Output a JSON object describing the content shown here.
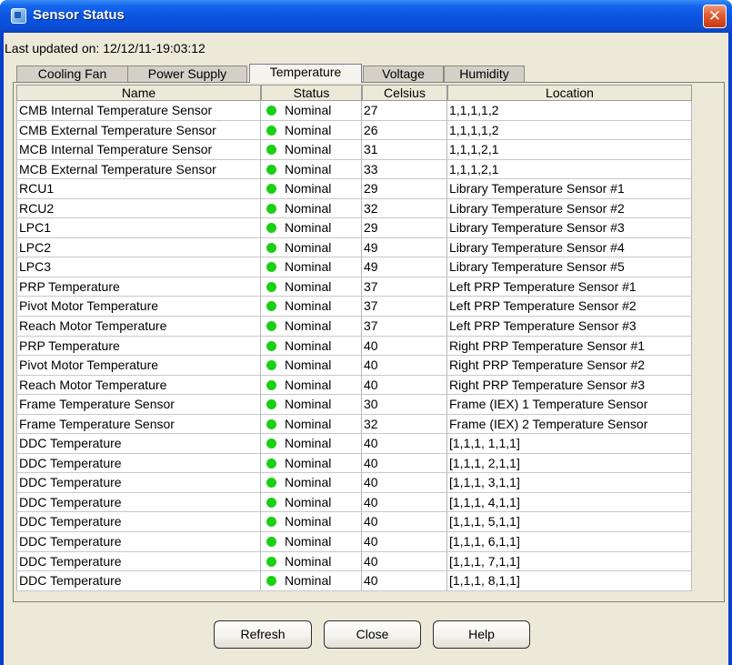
{
  "window": {
    "title": "Sensor Status",
    "close_glyph": "✕"
  },
  "last_updated": "Last updated on: 12/12/11-19:03:12",
  "tabs": [
    {
      "label": "Cooling Fan",
      "active": false
    },
    {
      "label": "Power Supply",
      "active": false
    },
    {
      "label": "Temperature",
      "active": true
    },
    {
      "label": "Voltage",
      "active": false
    },
    {
      "label": "Humidity",
      "active": false
    }
  ],
  "table": {
    "headers": [
      "Name",
      "Status",
      "Celsius",
      "Location"
    ],
    "rows": [
      {
        "name": "CMB Internal Temperature Sensor",
        "status": "Nominal",
        "celsius": "27",
        "location": "1,1,1,1,2"
      },
      {
        "name": "CMB External Temperature Sensor",
        "status": "Nominal",
        "celsius": "26",
        "location": "1,1,1,1,2"
      },
      {
        "name": "MCB Internal Temperature Sensor",
        "status": "Nominal",
        "celsius": "31",
        "location": "1,1,1,2,1"
      },
      {
        "name": "MCB External Temperature Sensor",
        "status": "Nominal",
        "celsius": "33",
        "location": "1,1,1,2,1"
      },
      {
        "name": "RCU1",
        "status": "Nominal",
        "celsius": "29",
        "location": "Library Temperature Sensor #1"
      },
      {
        "name": "RCU2",
        "status": "Nominal",
        "celsius": "32",
        "location": "Library Temperature Sensor #2"
      },
      {
        "name": "LPC1",
        "status": "Nominal",
        "celsius": "29",
        "location": "Library Temperature Sensor #3"
      },
      {
        "name": "LPC2",
        "status": "Nominal",
        "celsius": "49",
        "location": "Library Temperature Sensor #4"
      },
      {
        "name": "LPC3",
        "status": "Nominal",
        "celsius": "49",
        "location": "Library Temperature Sensor #5"
      },
      {
        "name": "PRP Temperature",
        "status": "Nominal",
        "celsius": "37",
        "location": "Left PRP Temperature Sensor #1"
      },
      {
        "name": "Pivot Motor Temperature",
        "status": "Nominal",
        "celsius": "37",
        "location": "Left PRP Temperature Sensor #2"
      },
      {
        "name": "Reach Motor Temperature",
        "status": "Nominal",
        "celsius": "37",
        "location": "Left PRP Temperature Sensor #3"
      },
      {
        "name": "PRP Temperature",
        "status": "Nominal",
        "celsius": "40",
        "location": "Right PRP Temperature Sensor #1"
      },
      {
        "name": "Pivot Motor Temperature",
        "status": "Nominal",
        "celsius": "40",
        "location": "Right PRP Temperature Sensor #2"
      },
      {
        "name": "Reach Motor Temperature",
        "status": "Nominal",
        "celsius": "40",
        "location": "Right PRP Temperature Sensor #3"
      },
      {
        "name": "Frame Temperature Sensor",
        "status": "Nominal",
        "celsius": "30",
        "location": "Frame (IEX) 1 Temperature Sensor"
      },
      {
        "name": "Frame Temperature Sensor",
        "status": "Nominal",
        "celsius": "32",
        "location": "Frame (IEX) 2 Temperature Sensor"
      },
      {
        "name": "DDC Temperature",
        "status": "Nominal",
        "celsius": "40",
        "location": "[1,1,1, 1,1,1]"
      },
      {
        "name": "DDC Temperature",
        "status": "Nominal",
        "celsius": "40",
        "location": "[1,1,1, 2,1,1]"
      },
      {
        "name": "DDC Temperature",
        "status": "Nominal",
        "celsius": "40",
        "location": "[1,1,1, 3,1,1]"
      },
      {
        "name": "DDC Temperature",
        "status": "Nominal",
        "celsius": "40",
        "location": "[1,1,1, 4,1,1]"
      },
      {
        "name": "DDC Temperature",
        "status": "Nominal",
        "celsius": "40",
        "location": "[1,1,1, 5,1,1]"
      },
      {
        "name": "DDC Temperature",
        "status": "Nominal",
        "celsius": "40",
        "location": "[1,1,1, 6,1,1]"
      },
      {
        "name": "DDC Temperature",
        "status": "Nominal",
        "celsius": "40",
        "location": "[1,1,1, 7,1,1]"
      },
      {
        "name": "DDC Temperature",
        "status": "Nominal",
        "celsius": "40",
        "location": "[1,1,1, 8,1,1]"
      }
    ]
  },
  "status_icon": {
    "name": "status-dot-icon",
    "color": "#19d012"
  },
  "buttons": {
    "refresh": "Refresh",
    "close": "Close",
    "help": "Help"
  },
  "colors": {
    "titlebar": "#0b53df",
    "dialog_bg": "#ece9d8",
    "close_button": "#e05a2f"
  }
}
